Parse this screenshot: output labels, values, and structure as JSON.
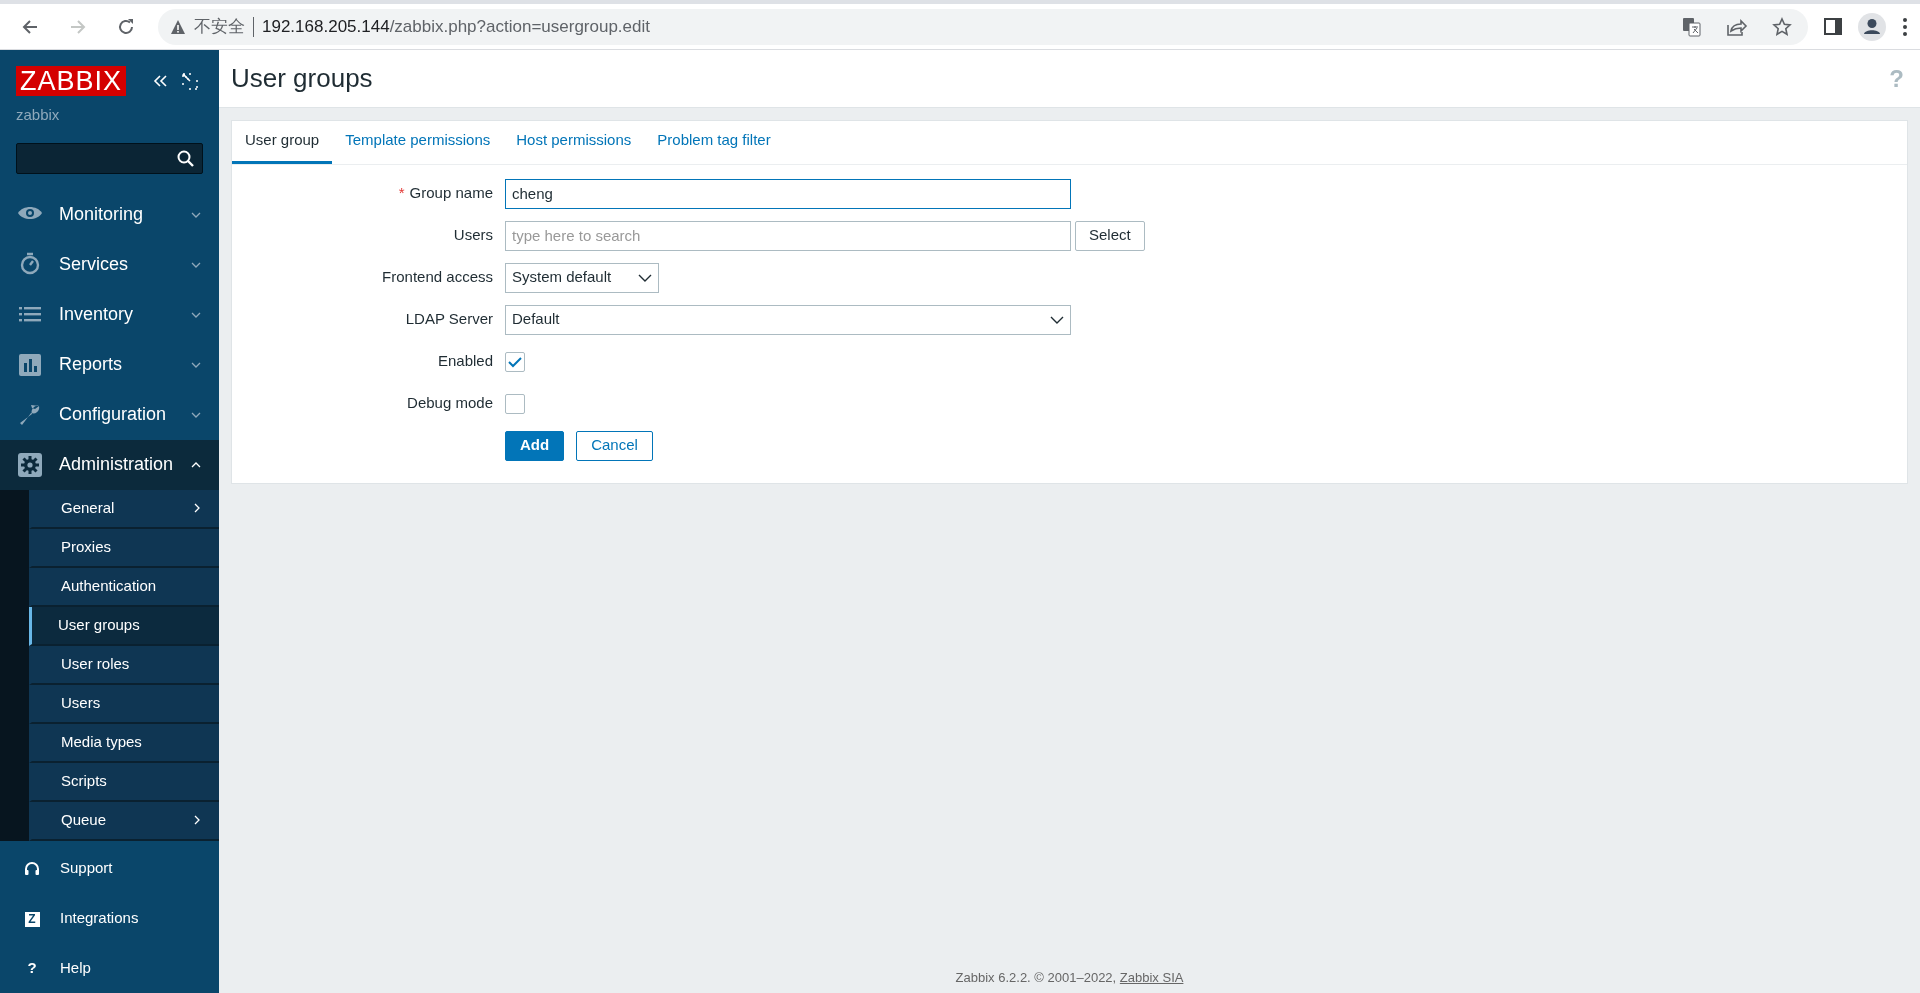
{
  "browser": {
    "back_enabled": true,
    "forward_enabled": false,
    "security_label": "不安全",
    "url_host": "192.168.205.144",
    "url_path": "/zabbix.php?action=usergroup.edit"
  },
  "sidebar": {
    "logo": "ZABBIX",
    "server_name": "zabbix",
    "menu": [
      {
        "label": "Monitoring",
        "expanded": false,
        "selected": false
      },
      {
        "label": "Services",
        "expanded": false,
        "selected": false
      },
      {
        "label": "Inventory",
        "expanded": false,
        "selected": false
      },
      {
        "label": "Reports",
        "expanded": false,
        "selected": false
      },
      {
        "label": "Configuration",
        "expanded": false,
        "selected": false
      },
      {
        "label": "Administration",
        "expanded": true,
        "selected": true,
        "children": [
          {
            "label": "General",
            "has_submenu": true,
            "selected": false
          },
          {
            "label": "Proxies",
            "has_submenu": false,
            "selected": false
          },
          {
            "label": "Authentication",
            "has_submenu": false,
            "selected": false
          },
          {
            "label": "User groups",
            "has_submenu": false,
            "selected": true
          },
          {
            "label": "User roles",
            "has_submenu": false,
            "selected": false
          },
          {
            "label": "Users",
            "has_submenu": false,
            "selected": false
          },
          {
            "label": "Media types",
            "has_submenu": false,
            "selected": false
          },
          {
            "label": "Scripts",
            "has_submenu": false,
            "selected": false
          },
          {
            "label": "Queue",
            "has_submenu": true,
            "selected": false
          }
        ]
      }
    ],
    "bottom_links": [
      {
        "label": "Support"
      },
      {
        "label": "Integrations",
        "icon_text": "Z"
      },
      {
        "label": "Help",
        "icon_text": "?"
      }
    ]
  },
  "page": {
    "title": "User groups",
    "help_mark": "?"
  },
  "tabs": [
    {
      "label": "User group",
      "selected": true
    },
    {
      "label": "Template permissions",
      "selected": false
    },
    {
      "label": "Host permissions",
      "selected": false
    },
    {
      "label": "Problem tag filter",
      "selected": false
    }
  ],
  "form": {
    "fields": [
      {
        "kind": "text",
        "label": "Group name",
        "required_mark": "*",
        "value": "cheng",
        "focused": true
      },
      {
        "kind": "multiselect",
        "label": "Users",
        "placeholder": "type here to search",
        "button": "Select"
      },
      {
        "kind": "combobox",
        "label": "Frontend access",
        "value": "System default"
      },
      {
        "kind": "select",
        "label": "LDAP Server",
        "value": "Default"
      },
      {
        "kind": "checkbox",
        "label": "Enabled",
        "checked": true
      },
      {
        "kind": "checkbox",
        "label": "Debug mode",
        "checked": false
      }
    ],
    "buttons": [
      {
        "label": "Add",
        "kind": "primary"
      },
      {
        "label": "Cancel",
        "kind": "secondary"
      }
    ]
  },
  "footer": {
    "text": "Zabbix 6.2.2. © 2001–2022,",
    "link": "Zabbix SIA"
  }
}
